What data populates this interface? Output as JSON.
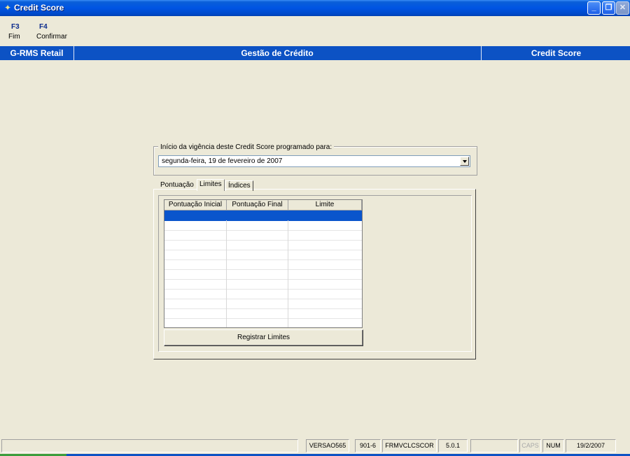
{
  "window": {
    "title": "Credit Score",
    "app_icon": "credit-score-app-icon",
    "buttons": {
      "minimize": "_",
      "restore": "❐",
      "close": "✕"
    }
  },
  "toolbar": {
    "items": [
      {
        "key": "F3",
        "label": "Fim"
      },
      {
        "key": "F4",
        "label": "Confirmar"
      }
    ]
  },
  "header": {
    "left": "G-RMS Retail",
    "center": "Gestão de Crédito",
    "right": "Credit Score"
  },
  "vigencia": {
    "legend": "Início da vigência deste Credit Score programado para:",
    "selected_date": "segunda-feira, 19 de  fevereiro  de 2007"
  },
  "tabs": [
    {
      "label": "Pontuação",
      "active": false
    },
    {
      "label": "Limites",
      "active": true
    },
    {
      "label": "Índices",
      "active": false
    }
  ],
  "grid": {
    "columns": [
      "Pontuação Inicial",
      "Pontuação Final",
      "Limite"
    ],
    "row_count": 12,
    "selected_row": 0
  },
  "register_button": "Registrar Limites",
  "statusbar": {
    "panels": [
      "",
      "VERSAO565",
      "901-6",
      "FRMVCLCSCOR",
      "5.0.1",
      "",
      "CAPS",
      "NUM",
      "19/2/2007"
    ]
  },
  "colors": {
    "titlebar": "#0054e3",
    "header_band": "#0c52c4",
    "selected_row": "#0a55cc",
    "background": "#ece9d8"
  }
}
